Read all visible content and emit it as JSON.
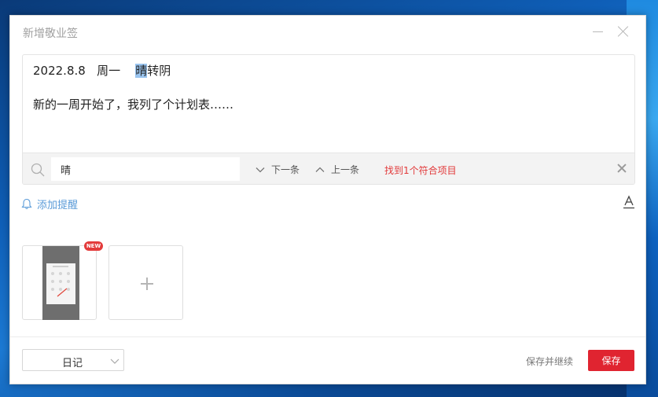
{
  "dialog": {
    "title": "新增敬业签"
  },
  "editor": {
    "line1_date": "2022.8.8",
    "line1_weekday": "周一",
    "line1_match": "晴",
    "line1_rest": "转阴",
    "line2": "新的一周开始了，我列了个计划表……"
  },
  "find": {
    "query": "晴",
    "next_label": "下一条",
    "prev_label": "上一条",
    "result": "找到1个符合项目"
  },
  "reminder": {
    "label": "添加提醒"
  },
  "attachments": {
    "badge": "NEW"
  },
  "footer": {
    "category": "日记",
    "save_continue_label": "保存并继续",
    "save_label": "保存"
  },
  "colors": {
    "accent_red": "#e02430",
    "link_blue": "#5a9bd8",
    "find_result_red": "#e2393a"
  }
}
